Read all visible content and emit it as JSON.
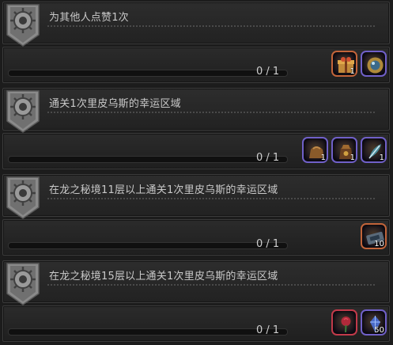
{
  "quests": [
    {
      "title": "为其他人点赞1次",
      "progress": "0 / 1",
      "rewards": [
        {
          "icon": "gift-box-icon",
          "qty": "1",
          "rarity": "orange"
        },
        {
          "icon": "orb-icon",
          "qty": "",
          "rarity": "purple"
        }
      ]
    },
    {
      "title": "通关1次里皮乌斯的幸运区域",
      "progress": "0 / 1",
      "rewards": [
        {
          "icon": "bag-icon",
          "qty": "1",
          "rarity": "purple"
        },
        {
          "icon": "pouch-icon",
          "qty": "1",
          "rarity": "purple"
        },
        {
          "icon": "feather-icon",
          "qty": "1",
          "rarity": "purple"
        }
      ]
    },
    {
      "title": "在龙之秘境11层以上通关1次里皮乌斯的幸运区域",
      "progress": "0 / 1",
      "rewards": [
        {
          "icon": "ticket-icon",
          "qty": "10",
          "rarity": "orange"
        }
      ]
    },
    {
      "title": "在龙之秘境15层以上通关1次里皮乌斯的幸运区域",
      "progress": "0 / 1",
      "rewards": [
        {
          "icon": "rose-icon",
          "qty": "",
          "rarity": "red"
        },
        {
          "icon": "crystal-icon",
          "qty": "50",
          "rarity": "purple"
        }
      ]
    }
  ]
}
